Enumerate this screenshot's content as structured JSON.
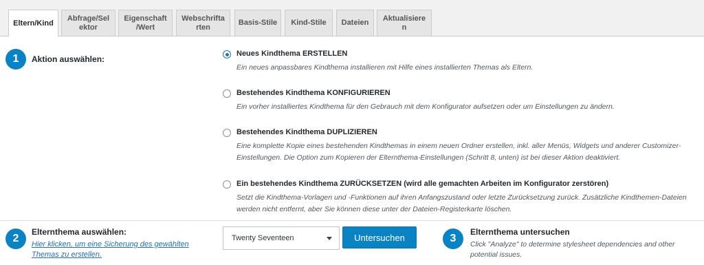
{
  "tabs": [
    {
      "label": "Eltern/Kind",
      "active": true
    },
    {
      "label": "Abfrage/Sel\nektor"
    },
    {
      "label": "Eigenschaft\n/Wert"
    },
    {
      "label": "Webschrifta\nrten"
    },
    {
      "label": "Basis-Stile"
    },
    {
      "label": "Kind-Stile"
    },
    {
      "label": "Dateien"
    },
    {
      "label": "Aktualisiere\nn"
    }
  ],
  "steps": {
    "action": {
      "number": "1",
      "label": "Aktion auswählen:"
    },
    "parent": {
      "number": "2",
      "label": "Elternthema auswählen:",
      "backup_link": "Hier klicken, um eine Sicherung des gewählten Themas zu erstellen."
    },
    "analyze": {
      "number": "3",
      "label": "Elternthema untersuchen",
      "description": "Click \"Analyze\" to determine stylesheet dependencies and other potential issues."
    }
  },
  "options": [
    {
      "title": "Neues Kindthema ERSTELLEN",
      "description": "Ein neues anpassbares Kindthema installieren mit Hilfe eines installierten Themas als Eltern.",
      "selected": true
    },
    {
      "title": "Bestehendes Kindthema KONFIGURIEREN",
      "description": "Ein vorher installiertes Kindthema für den Gebrauch mit dem Konfigurator aufsetzen oder um Einstellungen zu ändern.",
      "selected": false
    },
    {
      "title": "Bestehendes Kindthema DUPLIZIEREN",
      "description": "Eine komplette Kopie eines bestehenden Kindthemas in einem neuen Ordner erstellen, inkl. aller Menüs, Widgets und anderer Customizer-Einstellungen. Die Option zum Kopieren der Elternthema-Einstellungen (Schritt 8, unten) ist bei dieser Aktion deaktiviert.",
      "selected": false
    },
    {
      "title": "Ein bestehendes Kindthema ZURÜCKSETZEN (wird alle gemachten Arbeiten im Konfigurator zerstören)",
      "description": "Setzt die Kindthema-Vorlagen und -Funktionen auf ihren Anfangszustand oder letzte Zurücksetzung zurück. Zusätzliche Kindthemen-Dateien werden nicht entfernt, aber Sie können diese unter der Dateien-Registerkarte löschen.",
      "selected": false
    }
  ],
  "parent_select": {
    "value": "Twenty Seventeen"
  },
  "analyze_button": {
    "label": "Untersuchen"
  },
  "colors": {
    "accent": "#0a83c5",
    "link": "#2271b1"
  }
}
